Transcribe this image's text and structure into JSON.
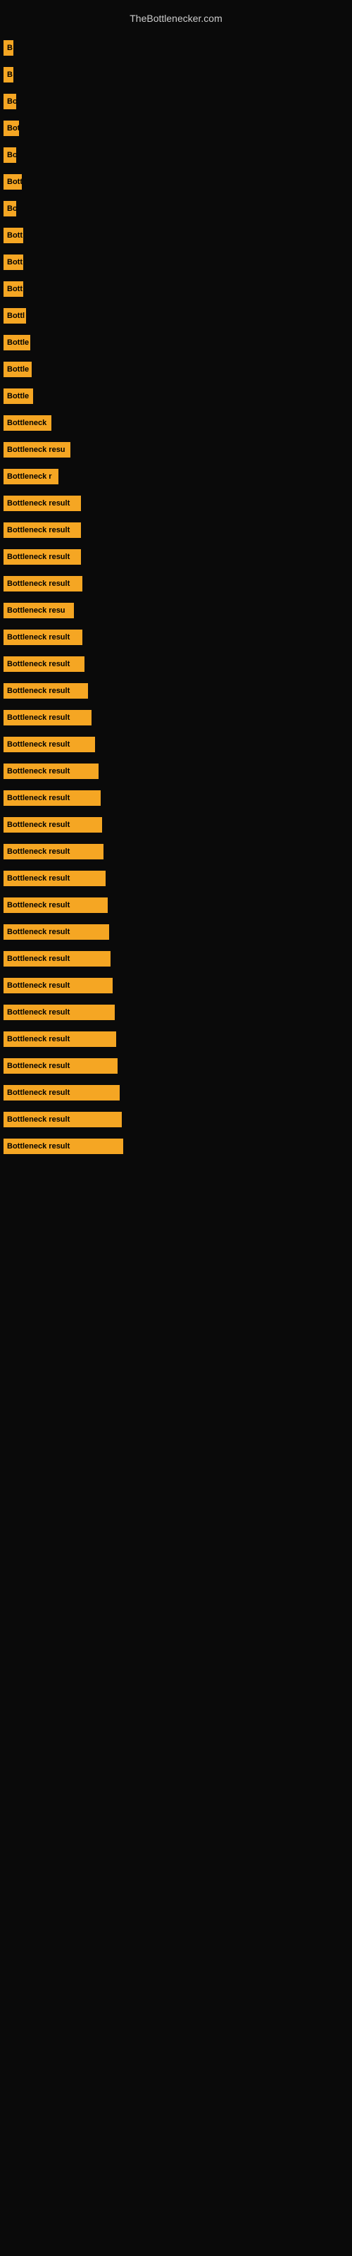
{
  "site": {
    "title": "TheBottlenecker.com"
  },
  "bars": [
    {
      "label": "B",
      "width": 14
    },
    {
      "label": "B",
      "width": 14
    },
    {
      "label": "Bo",
      "width": 18
    },
    {
      "label": "Bot",
      "width": 22
    },
    {
      "label": "Bo",
      "width": 18
    },
    {
      "label": "Bott",
      "width": 26
    },
    {
      "label": "Bo",
      "width": 18
    },
    {
      "label": "Bott",
      "width": 28
    },
    {
      "label": "Bott",
      "width": 28
    },
    {
      "label": "Bott",
      "width": 28
    },
    {
      "label": "Bottl",
      "width": 32
    },
    {
      "label": "Bottle",
      "width": 38
    },
    {
      "label": "Bottle",
      "width": 40
    },
    {
      "label": "Bottle",
      "width": 42
    },
    {
      "label": "Bottleneck",
      "width": 68
    },
    {
      "label": "Bottleneck resu",
      "width": 95
    },
    {
      "label": "Bottleneck r",
      "width": 78
    },
    {
      "label": "Bottleneck result",
      "width": 110
    },
    {
      "label": "Bottleneck result",
      "width": 110
    },
    {
      "label": "Bottleneck result",
      "width": 110
    },
    {
      "label": "Bottleneck result",
      "width": 112
    },
    {
      "label": "Bottleneck resu",
      "width": 100
    },
    {
      "label": "Bottleneck result",
      "width": 112
    },
    {
      "label": "Bottleneck result",
      "width": 115
    },
    {
      "label": "Bottleneck result",
      "width": 120
    },
    {
      "label": "Bottleneck result",
      "width": 125
    },
    {
      "label": "Bottleneck result",
      "width": 130
    },
    {
      "label": "Bottleneck result",
      "width": 135
    },
    {
      "label": "Bottleneck result",
      "width": 138
    },
    {
      "label": "Bottleneck result",
      "width": 140
    },
    {
      "label": "Bottleneck result",
      "width": 142
    },
    {
      "label": "Bottleneck result",
      "width": 145
    },
    {
      "label": "Bottleneck result",
      "width": 148
    },
    {
      "label": "Bottleneck result",
      "width": 150
    },
    {
      "label": "Bottleneck result",
      "width": 152
    },
    {
      "label": "Bottleneck result",
      "width": 155
    },
    {
      "label": "Bottleneck result",
      "width": 158
    },
    {
      "label": "Bottleneck result",
      "width": 160
    },
    {
      "label": "Bottleneck result",
      "width": 162
    },
    {
      "label": "Bottleneck result",
      "width": 165
    },
    {
      "label": "Bottleneck result",
      "width": 168
    },
    {
      "label": "Bottleneck result",
      "width": 170
    }
  ]
}
